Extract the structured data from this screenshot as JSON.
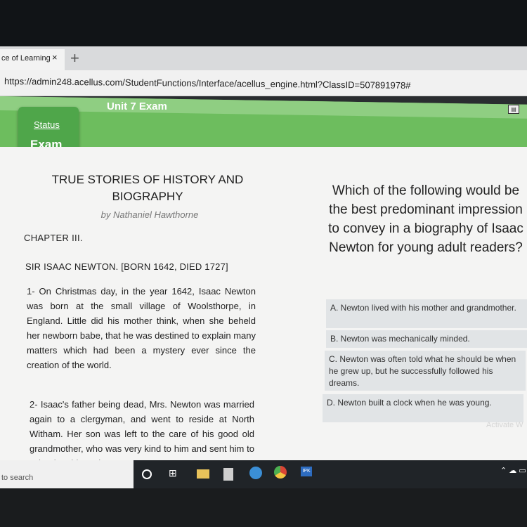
{
  "browser": {
    "tab_title": "ce of Learning",
    "tab_close": "×",
    "new_tab": "+",
    "url": "https://admin248.acellus.com/StudentFunctions/Interface/acellus_engine.html?ClassID=507891978#"
  },
  "header": {
    "title": "Unit 7 Exam",
    "status_link": "Status",
    "exam_label": "Exam"
  },
  "passage": {
    "title_line1": "TRUE STORIES OF HISTORY AND",
    "title_line2": "BIOGRAPHY",
    "author": "by Nathaniel Hawthorne",
    "chapter": "CHAPTER III.",
    "subject": "SIR ISAAC NEWTON.  [BORN 1642, DIED 1727]",
    "paragraph1": "1-   On Christmas day, in the year 1642, Isaac Newton was born at the small village of Woolsthorpe, in England. Little did his mother think, when she beheld her newborn babe, that he was destined to explain many matters which had been a mystery ever since the creation of the world.",
    "paragraph2": "2-   Isaac's father being dead, Mrs. Newton was married again to a clergyman, and went to reside at North Witham. Her son was left to the care of his good old grandmother, who was very kind to him and sent him to school. In his early years"
  },
  "question": {
    "text": "Which of the following would be the best predominant impression to convey in a biography of Isaac Newton for young adult readers?"
  },
  "answers": [
    {
      "text": "A. Newton lived with his mother and grandmother."
    },
    {
      "text": "B. Newton was mechanically minded."
    },
    {
      "text": "C. Newton was often told what he should be when he grew up, but he successfully followed his dreams."
    },
    {
      "text": "D. Newton built a clock when he was young."
    }
  ],
  "watermark": "Activate W",
  "taskbar": {
    "search_text": "to search",
    "app_label": "IPK"
  }
}
